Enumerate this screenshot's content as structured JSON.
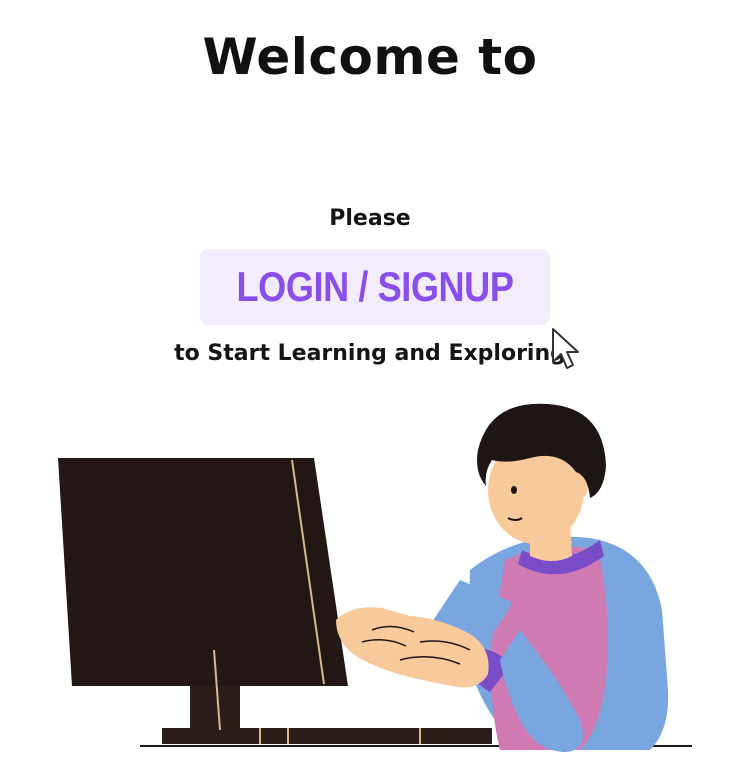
{
  "header": {
    "title": "Welcome to"
  },
  "prompt": {
    "before": "Please",
    "button_label": "LOGIN / SIGNUP",
    "after": "to Start Learning and Exploring"
  },
  "colors": {
    "button_bg": "#f2ecfd",
    "button_text": "#8a4fea",
    "text": "#151515"
  },
  "icons": {
    "cursor": "mouse-pointer-icon",
    "illustration": "person-at-computer-illustration"
  }
}
